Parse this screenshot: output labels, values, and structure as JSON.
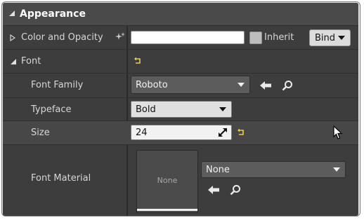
{
  "section": {
    "title": "Appearance"
  },
  "color_opacity": {
    "label": "Color and Opacity",
    "value": "",
    "inherit_label": "Inherit",
    "bind_label": "Bind"
  },
  "font": {
    "label": "Font",
    "family": {
      "label": "Font Family",
      "value": "Roboto"
    },
    "typeface": {
      "label": "Typeface",
      "value": "Bold"
    },
    "size": {
      "label": "Size",
      "value": "24"
    },
    "material": {
      "label": "Font Material",
      "preview_text": "None",
      "value": "None"
    }
  },
  "colors": {
    "accent_yellow": "#e6d04a",
    "panel": "#3d3d3d"
  }
}
